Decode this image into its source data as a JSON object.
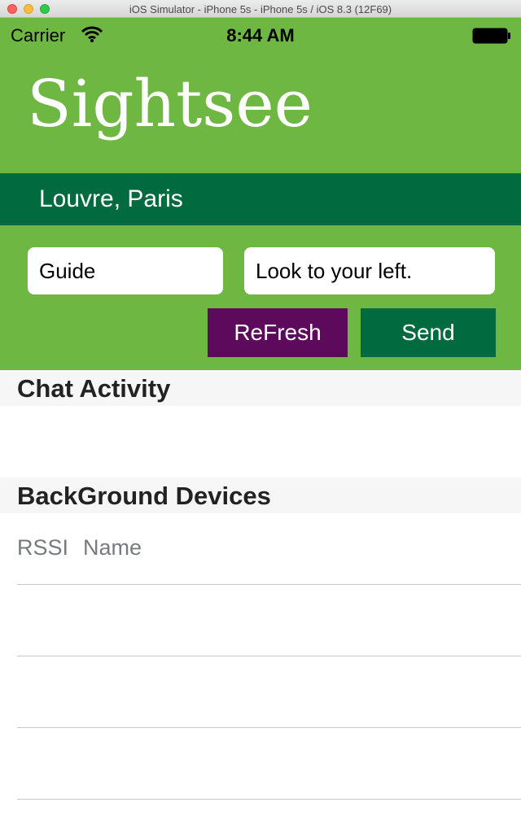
{
  "window": {
    "title": "iOS Simulator - iPhone 5s - iPhone 5s / iOS 8.3 (12F69)"
  },
  "status_bar": {
    "carrier": "Carrier",
    "time": "8:44 AM"
  },
  "app": {
    "title": "Sightsee",
    "location": "Louvre, Paris"
  },
  "form": {
    "guide_value": "Guide",
    "message_value": "Look to your left.",
    "refresh_label": "ReFresh",
    "send_label": "Send"
  },
  "sections": {
    "chat_title": "Chat Activity",
    "devices_title": "BackGround Devices",
    "devices_columns": [
      "RSSI",
      "Name"
    ]
  },
  "colors": {
    "header_green": "#6db742",
    "location_bar": "#026a3f",
    "refresh_button": "#5e0a5c",
    "send_button": "#026a3f"
  },
  "icons": [
    "wifi-icon",
    "battery-icon"
  ]
}
